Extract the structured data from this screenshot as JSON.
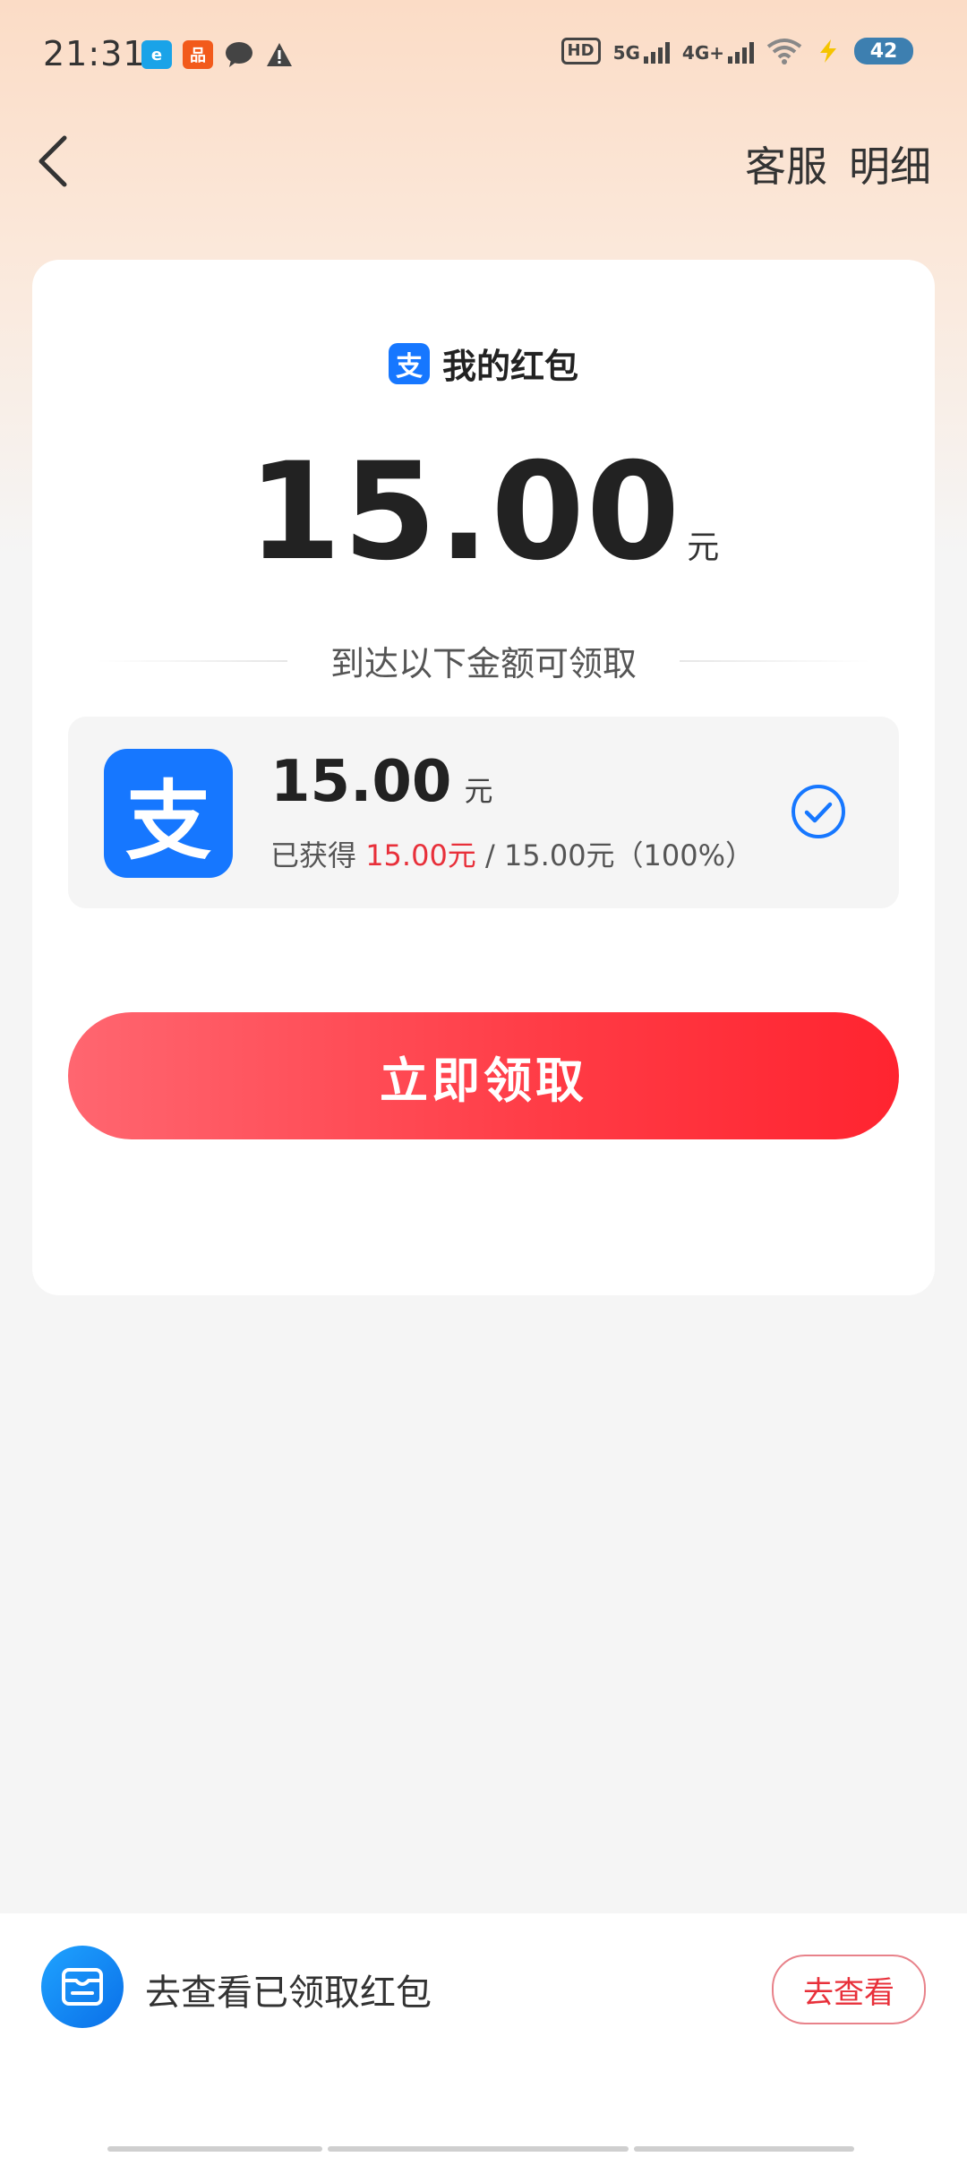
{
  "status_bar": {
    "time": "21:31",
    "battery": "42",
    "network_1": "5G",
    "network_2": "4G+",
    "hd_label": "HD"
  },
  "nav": {
    "back_icon": "chevron-left-icon",
    "service_label": "客服",
    "detail_label": "明细"
  },
  "card": {
    "title": "我的红包",
    "brand_glyph": "支",
    "amount": "15.00",
    "amount_unit": "元",
    "condition_text": "到达以下金额可领取",
    "reward": {
      "amount": "15.00",
      "unit": "元",
      "progress_prefix": "已获得 ",
      "progress_earned": "15.00元",
      "progress_suffix": " / 15.00元（100%）",
      "progress_percent": 100
    },
    "claim_button": "立即领取"
  },
  "bottom": {
    "text": "去查看已领取红包",
    "button": "去查看"
  },
  "colors": {
    "accent_red": "#ff3a44",
    "alipay_blue": "#1677ff",
    "check_blue": "#1677ff"
  }
}
